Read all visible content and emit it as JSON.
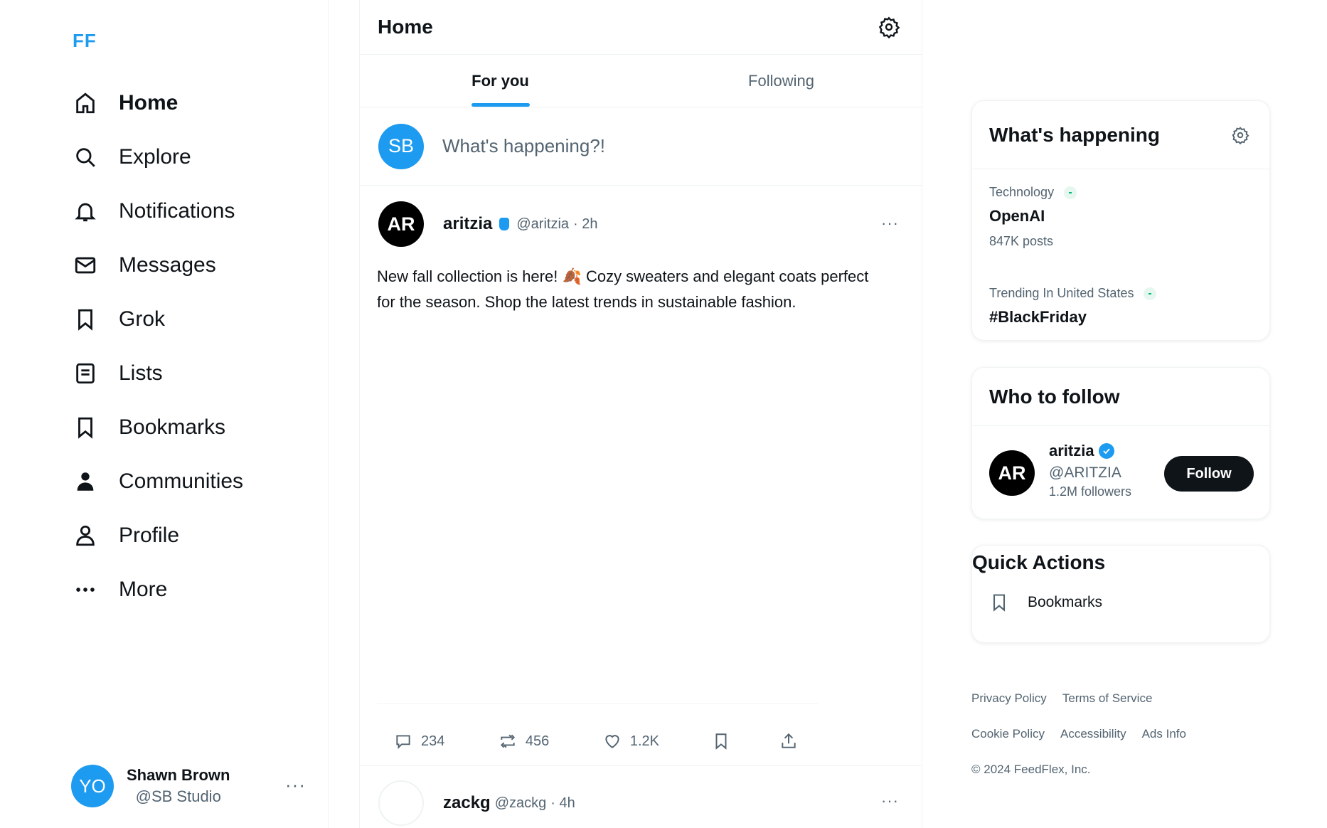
{
  "app": {
    "logo": "FF"
  },
  "sidebar": {
    "items": [
      {
        "label": "Home",
        "icon": "home-icon"
      },
      {
        "label": "Explore",
        "icon": "search-icon"
      },
      {
        "label": "Notifications",
        "icon": "bell-icon"
      },
      {
        "label": "Messages",
        "icon": "envelope-icon"
      },
      {
        "label": "Grok",
        "icon": "bookmark-icon"
      },
      {
        "label": "Lists",
        "icon": "list-icon"
      },
      {
        "label": "Bookmarks",
        "icon": "bookmark-icon"
      },
      {
        "label": "Communities",
        "icon": "people-icon"
      },
      {
        "label": "Profile",
        "icon": "person-icon"
      },
      {
        "label": "More",
        "icon": "more-icon"
      }
    ],
    "account": {
      "initials": "YO",
      "name": "Shawn Brown",
      "handle": "@SB Studio",
      "more": "···"
    }
  },
  "main": {
    "title": "Home",
    "tabs": [
      {
        "label": "For you"
      },
      {
        "label": "Following"
      }
    ],
    "compose": {
      "initials": "SB",
      "placeholder": "What's happening?!"
    },
    "posts": [
      {
        "initials": "AR",
        "name": "aritzia",
        "handle": "@aritzia",
        "time": "· 2h",
        "more": "···",
        "text": "New fall collection is here! 🍂 Cozy sweaters and elegant coats perfect for the season. Shop the latest trends in sustainable fashion.",
        "replies": "234",
        "reposts": "456",
        "likes": "1.2K"
      },
      {
        "name": "zackg",
        "handle": "@zackg",
        "time": "· 4h",
        "more": "···"
      }
    ]
  },
  "right": {
    "trends": {
      "title": "What's happening",
      "items": [
        {
          "category": "Technology",
          "name": "OpenAI",
          "count": "847K posts"
        },
        {
          "category": "Trending In United States",
          "name": "#BlackFriday"
        }
      ]
    },
    "who_to_follow": {
      "title": "Who to follow",
      "user": {
        "initials": "AR",
        "name": "aritzia",
        "handle": "@ARITZIA",
        "followers": "1.2M followers",
        "button": "Follow"
      }
    },
    "quick_actions": {
      "title": "Quick Actions",
      "items": [
        {
          "label": "Bookmarks",
          "icon": "bookmark-icon"
        }
      ]
    },
    "footer": {
      "links_row1": [
        "Privacy Policy",
        "Terms of Service"
      ],
      "links_row2": [
        "Cookie Policy",
        "Accessibility",
        "Ads Info"
      ],
      "copyright": "© 2024 FeedFlex, Inc."
    }
  },
  "colors": {
    "accent": "#1d9bf0",
    "text": "#0f1419",
    "muted": "#536471",
    "border": "#eff3f4"
  }
}
